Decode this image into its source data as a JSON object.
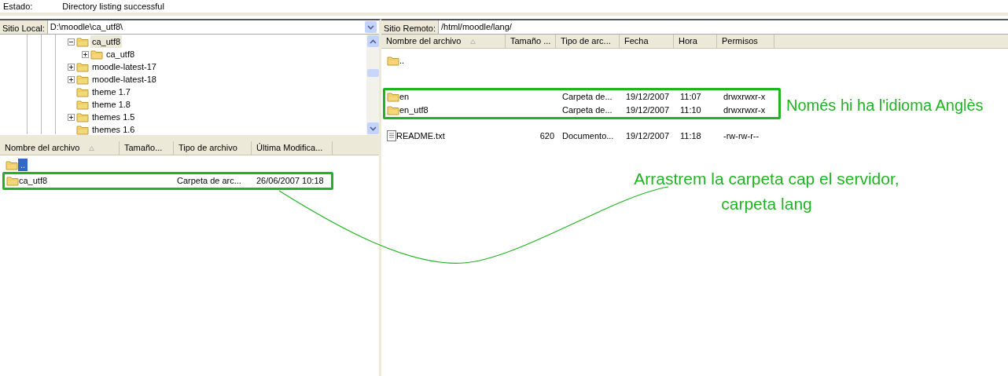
{
  "status_line": {
    "label": "Estado:",
    "message": "Directory listing successful"
  },
  "local": {
    "label": "Sitio Local:",
    "path": "D:\\moodle\\ca_utf8\\",
    "tree": [
      {
        "label": "ca_utf8",
        "kind": "expandable",
        "expanded": true,
        "selected": true,
        "children": [
          {
            "label": "ca_utf8",
            "kind": "expandable",
            "expanded": false,
            "selected": false
          }
        ]
      },
      {
        "label": "moodle-latest-17",
        "kind": "expandable",
        "expanded": false,
        "selected": false
      },
      {
        "label": "moodle-latest-18",
        "kind": "expandable",
        "expanded": false,
        "selected": false
      },
      {
        "label": "theme 1.7",
        "kind": "leaf",
        "selected": false
      },
      {
        "label": "theme 1.8",
        "kind": "leaf",
        "selected": false
      },
      {
        "label": "themes 1.5",
        "kind": "expandable",
        "expanded": false,
        "selected": false
      },
      {
        "label": "themes 1.6",
        "kind": "leaf",
        "selected": false
      }
    ],
    "columns": [
      "Nombre del archivo",
      "Tamaño...",
      "Tipo de archivo",
      "Última Modifica..."
    ],
    "rows": [
      {
        "kind": "parent",
        "name": "..",
        "selected": true,
        "highlighted": false
      },
      {
        "kind": "folder",
        "name": "ca_utf8",
        "type": "Carpeta de arc...",
        "modified": "26/06/2007 10:18",
        "selected": false,
        "highlighted": true
      }
    ]
  },
  "remote": {
    "label": "Sitio Remoto:",
    "path": "/html/moodle/lang/",
    "columns": [
      "Nombre del archivo",
      "Tamaño ...",
      "Tipo de arc...",
      "Fecha",
      "Hora",
      "Permisos"
    ],
    "rows": [
      {
        "kind": "parent",
        "name": "..",
        "highlighted": false
      },
      {
        "kind": "folder",
        "name": "en",
        "type": "Carpeta de...",
        "date": "19/12/2007",
        "time": "11:07",
        "perms": "drwxrwxr-x",
        "highlighted": true
      },
      {
        "kind": "folder",
        "name": "en_utf8",
        "type": "Carpeta de...",
        "date": "19/12/2007",
        "time": "11:10",
        "perms": "drwxrwxr-x",
        "highlighted": true
      },
      {
        "kind": "file",
        "name": "README.txt",
        "size": "620",
        "type": "Documento...",
        "date": "19/12/2007",
        "time": "11:18",
        "perms": "-rw-rw-r--",
        "highlighted": false
      }
    ]
  },
  "annotations": {
    "remote_note": "Només hi ha l'idioma Anglès",
    "drag_note": [
      "Arrastrem la carpeta cap el servidor,",
      "carpeta lang"
    ]
  }
}
